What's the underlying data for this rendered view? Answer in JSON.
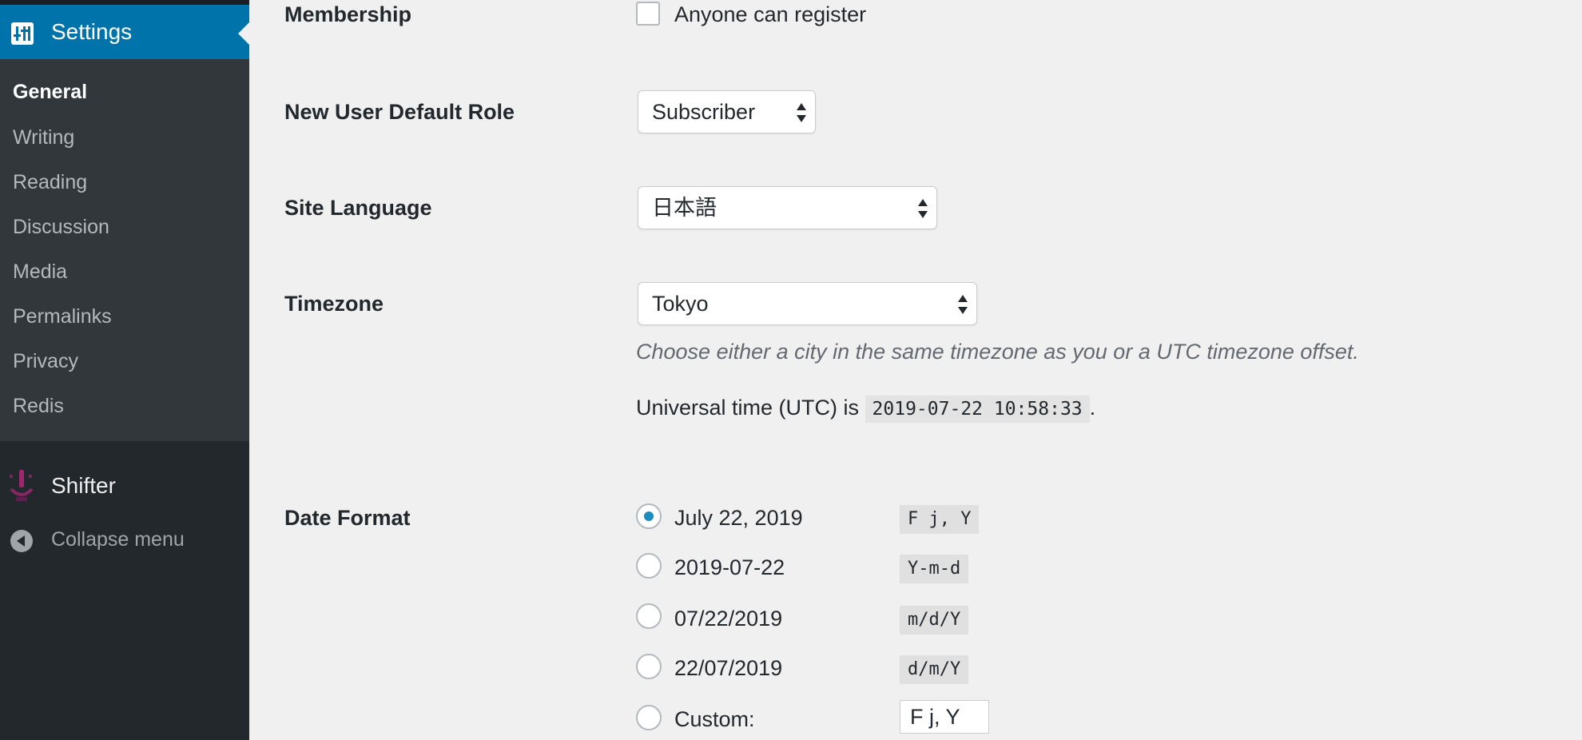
{
  "sidebar": {
    "settings_label": "Settings",
    "submenu": [
      {
        "label": "General",
        "current": true
      },
      {
        "label": "Writing"
      },
      {
        "label": "Reading"
      },
      {
        "label": "Discussion"
      },
      {
        "label": "Media"
      },
      {
        "label": "Permalinks"
      },
      {
        "label": "Privacy"
      },
      {
        "label": "Redis"
      }
    ],
    "shifter_label": "Shifter",
    "collapse_label": "Collapse menu",
    "active_color": "#0073aa"
  },
  "membership": {
    "label": "Membership",
    "checkbox_label": "Anyone can register",
    "checked": false
  },
  "default_role": {
    "label": "New User Default Role",
    "value": "Subscriber"
  },
  "site_language": {
    "label": "Site Language",
    "value": "日本語"
  },
  "timezone": {
    "label": "Timezone",
    "value": "Tokyo",
    "description": "Choose either a city in the same timezone as you or a UTC timezone offset.",
    "utc_prefix": "Universal time (UTC) is",
    "utc_value": "2019-07-22 10:58:33",
    "utc_suffix": "."
  },
  "date_format": {
    "label": "Date Format",
    "options": [
      {
        "label": "July 22, 2019",
        "code": "F j, Y",
        "checked": true
      },
      {
        "label": "2019-07-22",
        "code": "Y-m-d",
        "checked": false
      },
      {
        "label": "07/22/2019",
        "code": "m/d/Y",
        "checked": false
      },
      {
        "label": "22/07/2019",
        "code": "d/m/Y",
        "checked": false
      }
    ],
    "custom_label": "Custom:",
    "custom_value": "F j, Y"
  }
}
